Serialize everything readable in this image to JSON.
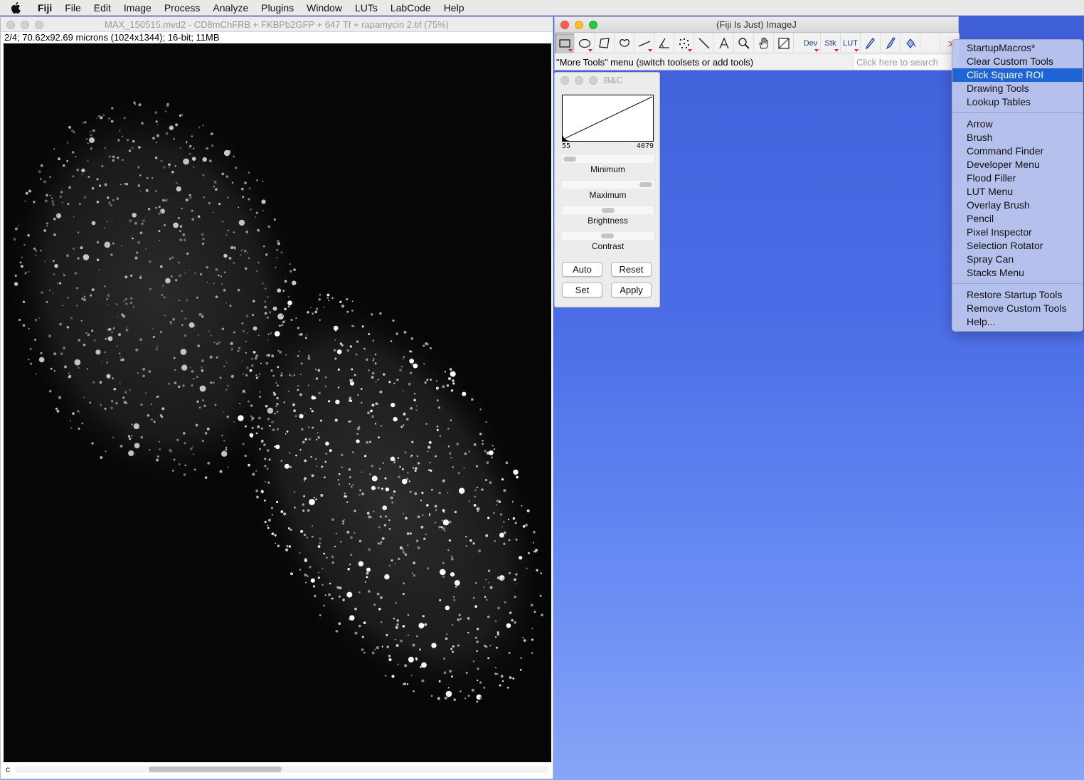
{
  "menubar": {
    "app": "Fiji",
    "items": [
      "File",
      "Edit",
      "Image",
      "Process",
      "Analyze",
      "Plugins",
      "Window",
      "LUTs",
      "LabCode",
      "Help"
    ]
  },
  "image_window": {
    "title": "MAX_150515.mvd2 - CD8mChFRB + FKBPb2GFP + 647 Tf + rapamycin 2.tif (75%)",
    "info": "2/4; 70.62x92.69 microns (1024x1344); 16-bit; 11MB",
    "channel_label": "c"
  },
  "fiji_window": {
    "title": "(Fiji Is Just) ImageJ",
    "tools": {
      "dev": "Dev",
      "stk": "Stk",
      "lut": "LUT",
      "more": "≫"
    },
    "status": "\"More Tools\" menu (switch toolsets or add tools)",
    "search_placeholder": "Click here to search"
  },
  "bc_window": {
    "title": "B&C",
    "min_value": "55",
    "max_value": "4079",
    "labels": {
      "minimum": "Minimum",
      "maximum": "Maximum",
      "brightness": "Brightness",
      "contrast": "Contrast"
    },
    "buttons": {
      "auto": "Auto",
      "reset": "Reset",
      "set": "Set",
      "apply": "Apply"
    }
  },
  "more_tools_menu": {
    "group1": [
      "StartupMacros*",
      "Clear Custom Tools",
      "Click Square ROI",
      "Drawing Tools",
      "Lookup Tables"
    ],
    "highlighted": "Click Square ROI",
    "group2": [
      "Arrow",
      "Brush",
      "Command Finder",
      "Developer Menu",
      "Flood Filler",
      "LUT Menu",
      "Overlay Brush",
      "Pencil",
      "Pixel Inspector",
      "Selection Rotator",
      "Spray Can",
      "Stacks Menu"
    ],
    "group3": [
      "Restore Startup Tools",
      "Remove Custom Tools",
      "Help..."
    ]
  },
  "colors": {
    "highlight": "#1f64d6",
    "desktop_top": "#3f5fd8",
    "desktop_bottom": "#87a6f7"
  }
}
